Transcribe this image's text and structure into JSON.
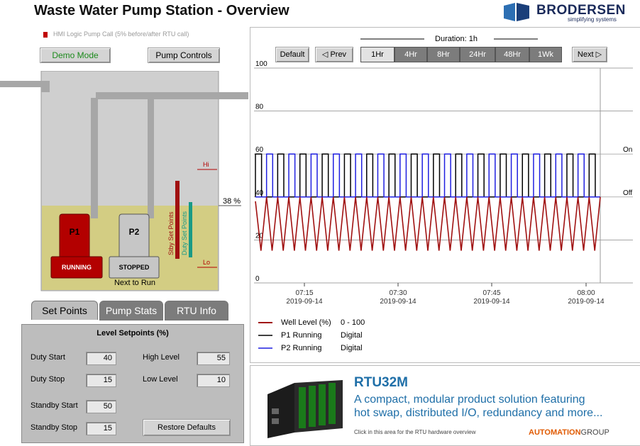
{
  "header": {
    "title": "Waste Water Pump Station - Overview",
    "logo_text": "BRODERSEN",
    "logo_sub": "simplifying systems"
  },
  "hmi_note": "HMI Logic Pump Call (5% before/after RTU call)",
  "buttons": {
    "demo_mode": "Demo Mode",
    "pump_controls": "Pump Controls"
  },
  "tank": {
    "level_label": "38 %",
    "level_fraction": 0.38,
    "hi_label": "Hi",
    "lo_label": "Lo",
    "stby_label": "Stby Set Points",
    "duty_label": "Duty Set Points",
    "p1": {
      "name": "P1",
      "status": "RUNNING"
    },
    "p2": {
      "name": "P2",
      "status": "STOPPED",
      "note": "Next to Run"
    },
    "colors": {
      "liquid": "#d3cd83",
      "tank": "#cfcfcf",
      "pipe": "#a7a7a7",
      "running": "#b30000",
      "stopped": "#c6c6c6",
      "duty_bar": "#1a9a86"
    }
  },
  "tabs": [
    {
      "label": "Set Points",
      "active": true
    },
    {
      "label": "Pump Stats",
      "active": false
    },
    {
      "label": "RTU Info",
      "active": false
    }
  ],
  "setpoints": {
    "header": "Level Setpoints (%)",
    "duty_start": {
      "label": "Duty Start",
      "value": "40"
    },
    "duty_stop": {
      "label": "Duty Stop",
      "value": "15"
    },
    "high_level": {
      "label": "High Level",
      "value": "55"
    },
    "low_level": {
      "label": "Low Level",
      "value": "10"
    },
    "standby_start": {
      "label": "Standby Start",
      "value": "50"
    },
    "standby_stop": {
      "label": "Standby Stop",
      "value": "15"
    },
    "restore": "Restore Defaults"
  },
  "chart_controls": {
    "duration_label": "Duration: 1h",
    "default": "Default",
    "prev": "Prev",
    "next": "Next",
    "durations": [
      "1Hr",
      "4Hr",
      "8Hr",
      "24Hr",
      "48Hr",
      "1Wk"
    ],
    "selected": "1Hr"
  },
  "chart_data": {
    "type": "line",
    "ylim": [
      0,
      100
    ],
    "yticks": [
      "0",
      "20",
      "40",
      "60",
      "80",
      "100"
    ],
    "xticks": [
      {
        "time": "07:15",
        "date": "2019-09-14"
      },
      {
        "time": "07:30",
        "date": "2019-09-14"
      },
      {
        "time": "07:45",
        "date": "2019-09-14"
      },
      {
        "time": "08:00",
        "date": "2019-09-14"
      }
    ],
    "digital_labels": {
      "on": "On",
      "off": "Off"
    },
    "series": [
      {
        "name": "Well Level (%)",
        "range": "0 - 100",
        "color": "#a01010",
        "description": "sawtooth between 15 and 40",
        "values": [
          38,
          15,
          40,
          15,
          40,
          15,
          40,
          15,
          40,
          15,
          40,
          15,
          40,
          15,
          40,
          15,
          40,
          15,
          40,
          15,
          40,
          15,
          40,
          15,
          40,
          15,
          40,
          15,
          40,
          15,
          40,
          15,
          40,
          15,
          40,
          15,
          40,
          15,
          40,
          15,
          40,
          15,
          40,
          15,
          40,
          15,
          40,
          15,
          40,
          15,
          40,
          15,
          40,
          15,
          40,
          15,
          40,
          15,
          40,
          15,
          40,
          15,
          40
        ]
      },
      {
        "name": "P1 Running",
        "range": "Digital",
        "color": "#000000"
      },
      {
        "name": "P2 Running",
        "range": "Digital",
        "color": "#1f1fe0"
      }
    ]
  },
  "ad": {
    "title": "RTU32M",
    "line1": "A compact, modular product solution featuring",
    "line2": "hot swap, distributed I/O, redundancy and more...",
    "note": "Click in this area for the RTU hardware overview",
    "brand_bold": "AUTOMATION",
    "brand_light": "GROUP"
  }
}
